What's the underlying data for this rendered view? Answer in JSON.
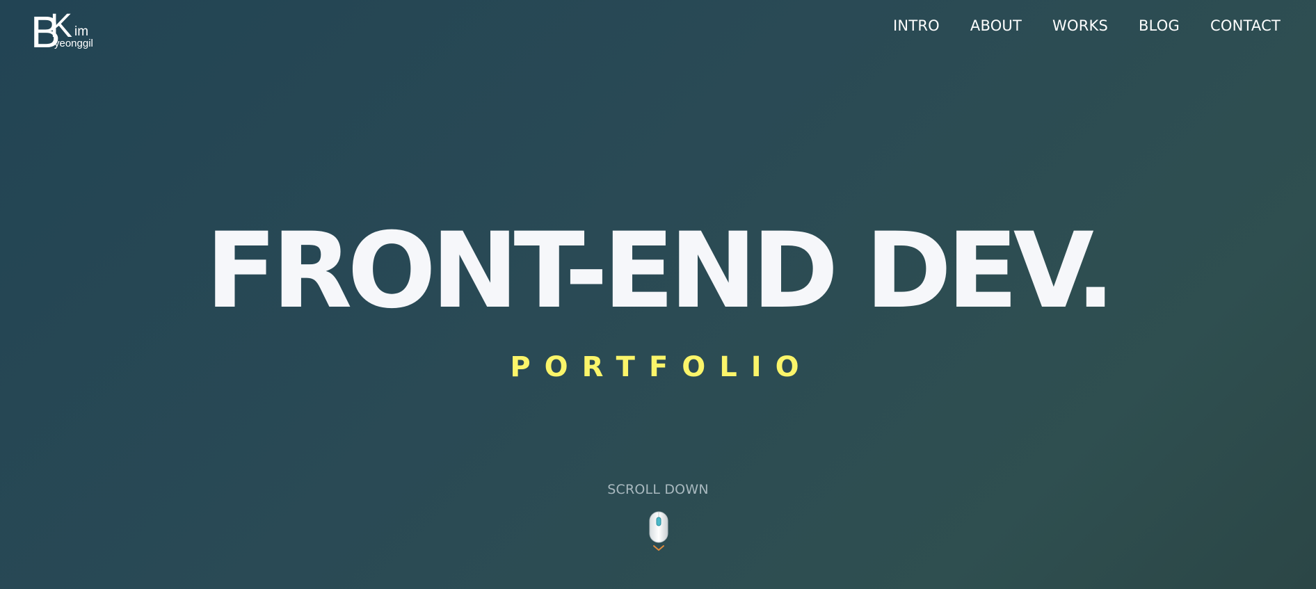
{
  "logo": {
    "big_b": "B",
    "big_k": "K",
    "small_im": "im",
    "small_name": "yeonggil"
  },
  "nav": {
    "items": [
      {
        "label": "INTRO"
      },
      {
        "label": "ABOUT"
      },
      {
        "label": "WORKS"
      },
      {
        "label": "BLOG"
      },
      {
        "label": "CONTACT"
      }
    ]
  },
  "hero": {
    "title": "FRONT-END DEV.",
    "subtitle": "PORTFOLIO"
  },
  "scroll": {
    "label": "SCROLL DOWN",
    "icon": "mouse-icon"
  },
  "colors": {
    "background_start": "#224454",
    "background_end": "#2b4646",
    "title": "#f6f7fa",
    "subtitle_accent": "#fbf56a",
    "scroll_text": "#a9b9bf",
    "chevron": "#e08a3c"
  }
}
